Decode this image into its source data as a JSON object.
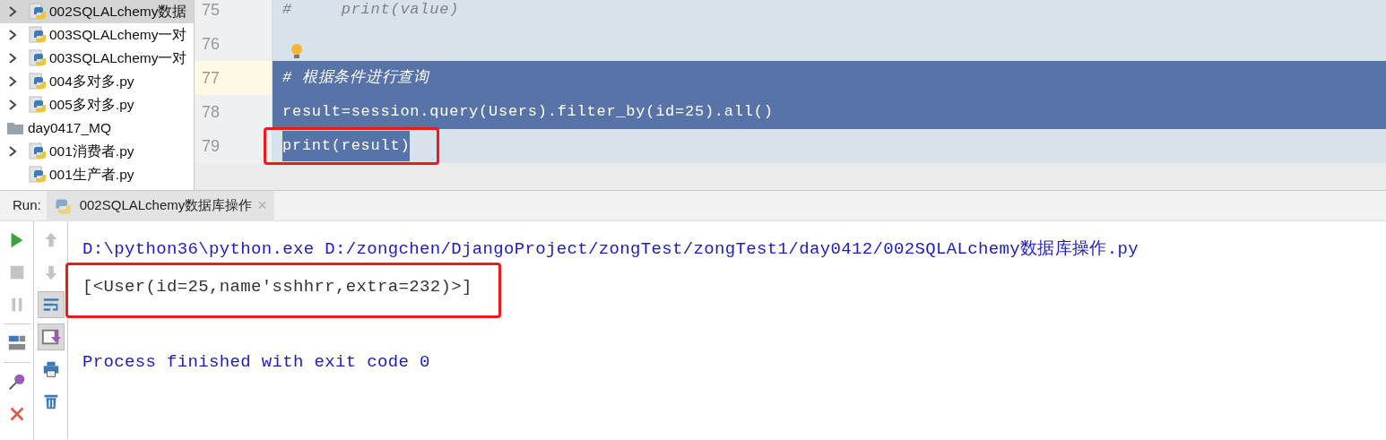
{
  "project_tree": [
    {
      "label": "002SQLALchemy数据",
      "kind": "file",
      "expandable": true,
      "selected": true
    },
    {
      "label": "003SQLALchemy一对",
      "kind": "file",
      "expandable": true,
      "selected": false
    },
    {
      "label": "003SQLALchemy一对",
      "kind": "file",
      "expandable": true,
      "selected": false
    },
    {
      "label": "004多对多.py",
      "kind": "file",
      "expandable": true,
      "selected": false
    },
    {
      "label": "005多对多.py",
      "kind": "file",
      "expandable": true,
      "selected": false
    },
    {
      "label": "day0417_MQ",
      "kind": "folder",
      "expandable": false,
      "selected": false
    },
    {
      "label": "001消费者.py",
      "kind": "file",
      "expandable": true,
      "selected": false
    },
    {
      "label": "001生产者.py",
      "kind": "file",
      "expandable": false,
      "selected": false
    }
  ],
  "editor": {
    "lines": [
      {
        "number": "75",
        "text": "#     print(value)",
        "kind": "comment",
        "selected": false,
        "selected_to_end": false,
        "current": false,
        "bulb": false,
        "boxed": false
      },
      {
        "number": "76",
        "kind": "code",
        "selected": false,
        "selected_to_end": false,
        "current": false,
        "bulb": true,
        "boxed": false
      },
      {
        "number": "77",
        "text": "# 根据条件进行查询",
        "kind": "comment",
        "selected": true,
        "selected_to_end": true,
        "current": true,
        "bulb": false,
        "boxed": false
      },
      {
        "number": "78",
        "text": "result=session.query(Users).filter_by(id=25).all()",
        "kind": "code",
        "selected": true,
        "selected_to_end": true,
        "current": false,
        "bulb": false,
        "boxed": false
      },
      {
        "number": "79",
        "text": "print(result)",
        "kind": "code",
        "selected": true,
        "selected_to_end": false,
        "current": false,
        "bulb": false,
        "boxed": true
      }
    ]
  },
  "run_panel": {
    "label": "Run:",
    "tabs": [
      {
        "title": "002SQLALchemy数据库操作",
        "close": "×",
        "selected": true
      }
    ],
    "right_tools": [
      {
        "kind": "up",
        "on": false
      },
      {
        "kind": "down",
        "on": false
      },
      {
        "kind": "wrap",
        "on": true
      },
      {
        "kind": "scroll",
        "on": true
      },
      {
        "kind": "print",
        "on": false
      },
      {
        "kind": "trash",
        "on": false
      }
    ],
    "console": [
      {
        "text": "D:\\python36\\python.exe D:/zongchen/DjangoProject/zongTest/zongTest1/day0412/002SQLALchemy数据库操作.py",
        "kind": "system",
        "boxed": false
      },
      {
        "text": "[<User(id=25,name'sshhrr,extra=232)>]",
        "kind": "output",
        "boxed": true
      },
      {
        "kind": "blank",
        "boxed": false
      },
      {
        "text": "Process finished with exit code 0",
        "kind": "system",
        "boxed": false
      }
    ]
  }
}
